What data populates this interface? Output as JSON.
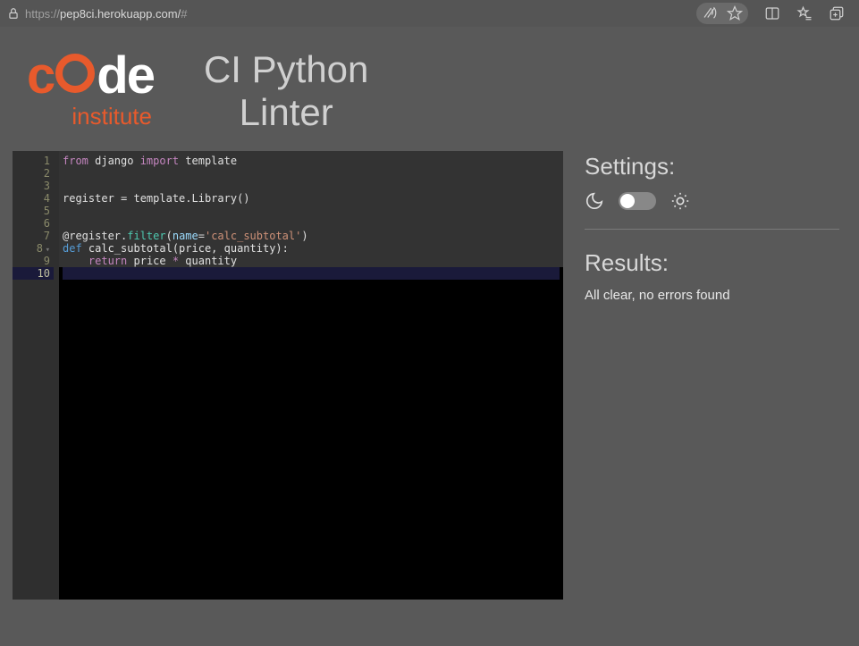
{
  "browser": {
    "url_proto": "https://",
    "url_host": "pep8ci.herokuapp.com",
    "url_path": "/",
    "url_hash": "#"
  },
  "header": {
    "logo_c": "c",
    "logo_d": "d",
    "logo_e": "e",
    "logo_sub": "institute",
    "title_line1": "CI Python",
    "title_line2": "Linter"
  },
  "editor": {
    "line_numbers": [
      "1",
      "2",
      "3",
      "4",
      "5",
      "6",
      "7",
      "8",
      "9",
      "10"
    ],
    "fold_line": "8",
    "active_line": "10",
    "code": {
      "l1_from": "from",
      "l1_mod": " django ",
      "l1_import": "import",
      "l1_target": " template",
      "l4": "register = template.Library()",
      "l7_at": "@register.",
      "l7_filter": "filter",
      "l7_open": "(",
      "l7_name": "name",
      "l7_eq": "=",
      "l7_str": "'calc_subtotal'",
      "l7_close": ")",
      "l8_def": "def",
      "l8_sig": " calc_subtotal(price, quantity):",
      "l9_indent": "    ",
      "l9_return": "return",
      "l9_mid": " price ",
      "l9_star": "*",
      "l9_end": " quantity"
    }
  },
  "right": {
    "settings_title": "Settings:",
    "results_title": "Results:",
    "results_text": "All clear, no errors found"
  }
}
